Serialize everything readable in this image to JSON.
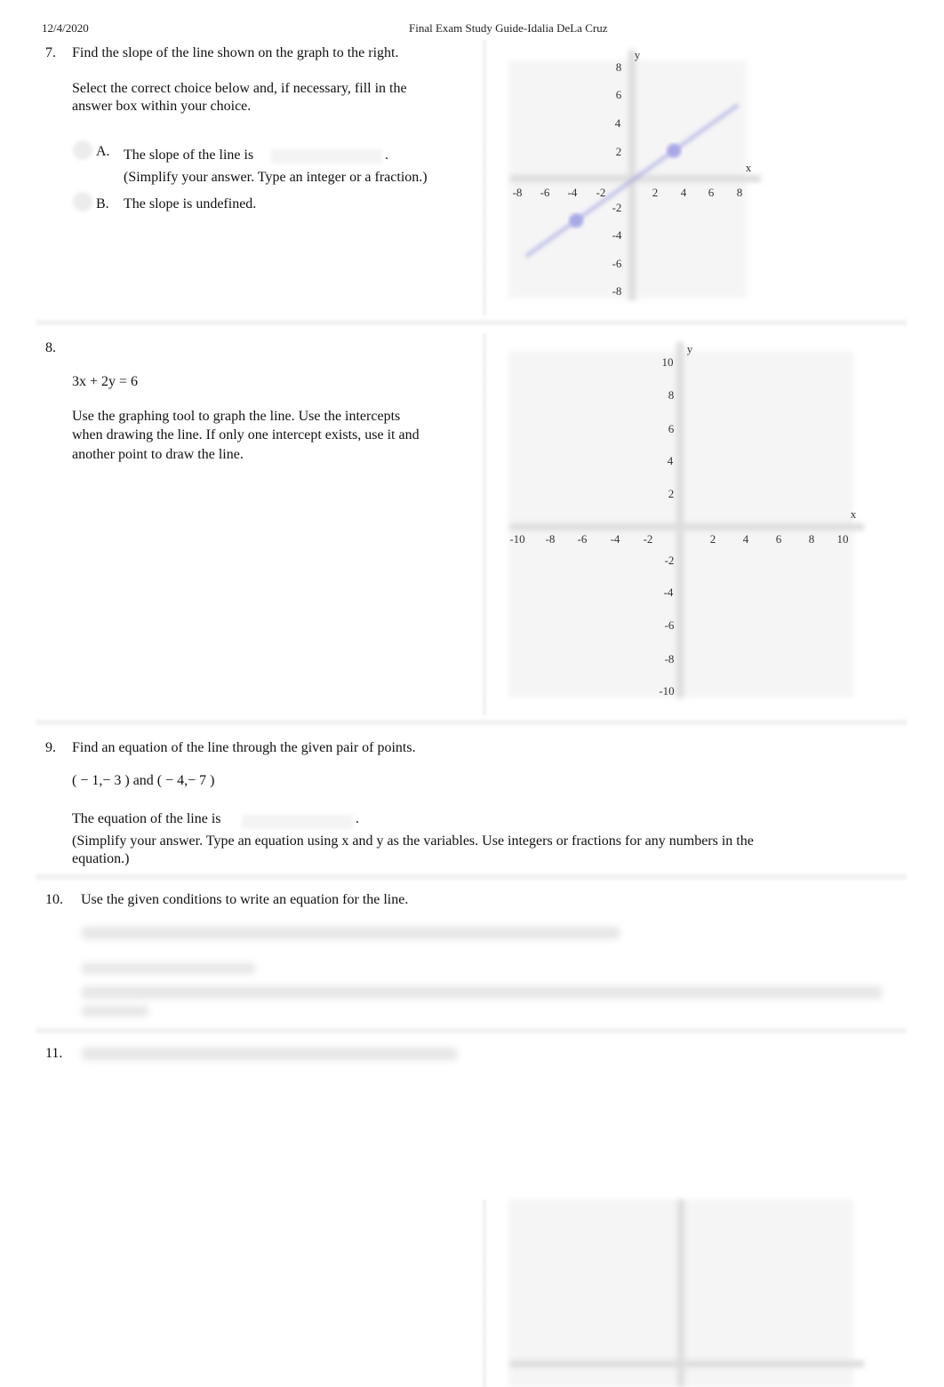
{
  "header": {
    "date": "12/4/2020",
    "title": "Final Exam Study Guide-Idalia DeLa Cruz"
  },
  "q7": {
    "number": "7.",
    "prompt": "Find the slope of the line shown on the graph to the right.",
    "instruction_1": "Select the correct choice below and, if necessary, fill in the",
    "instruction_2": "answer box within your choice.",
    "choice_a": {
      "letter": "A.",
      "text": "The slope of the line is",
      "period": ".",
      "hint": "(Simplify your answer. Type an integer or a fraction.)"
    },
    "choice_b": {
      "letter": "B.",
      "text": "The slope is undefined."
    },
    "graph": {
      "type": "line",
      "x_label": "x",
      "y_label": "y",
      "xlim": [
        -8,
        8
      ],
      "ylim": [
        -8,
        8
      ],
      "x_ticks": [
        "-8",
        "-6",
        "-4",
        "-2",
        "2",
        "4",
        "6",
        "8"
      ],
      "y_ticks": [
        "8",
        "6",
        "4",
        "2",
        "-2",
        "-4",
        "-6",
        "-8"
      ],
      "points": [
        [
          3,
          2
        ],
        [
          -4,
          -3
        ]
      ],
      "line_color": "#9a9ae0"
    }
  },
  "q8": {
    "number": "8.",
    "equation": "3x + 2y = 6",
    "instruction_1": "Use the graphing tool to graph the line. Use the intercepts",
    "instruction_2": "when drawing the line. If only one intercept exists, use it and",
    "instruction_3": "another point to draw the line.",
    "graph": {
      "x_label": "x",
      "y_label": "y",
      "xlim": [
        -10,
        10
      ],
      "ylim": [
        -10,
        10
      ],
      "x_ticks": [
        "-10",
        "-8",
        "-6",
        "-4",
        "-2",
        "2",
        "4",
        "6",
        "8",
        "10"
      ],
      "y_ticks": [
        "10",
        "8",
        "6",
        "4",
        "2",
        "-2",
        "-4",
        "-6",
        "-8",
        "-10"
      ]
    }
  },
  "q9": {
    "number": "9.",
    "prompt": "Find an equation of the line through the given pair of points.",
    "points": "( − 1,− 3 ) and ( − 4,− 7 )",
    "answer_text": "The equation of the line is",
    "period": ".",
    "hint_1": "(Simplify your answer. Type an equation using x and y as the variables. Use integers or fractions for any numbers in the",
    "hint_2": "equation.)"
  },
  "q10": {
    "number": "10.",
    "prompt": "Use the given conditions to write an equation for the line."
  },
  "q11": {
    "number": "11."
  }
}
